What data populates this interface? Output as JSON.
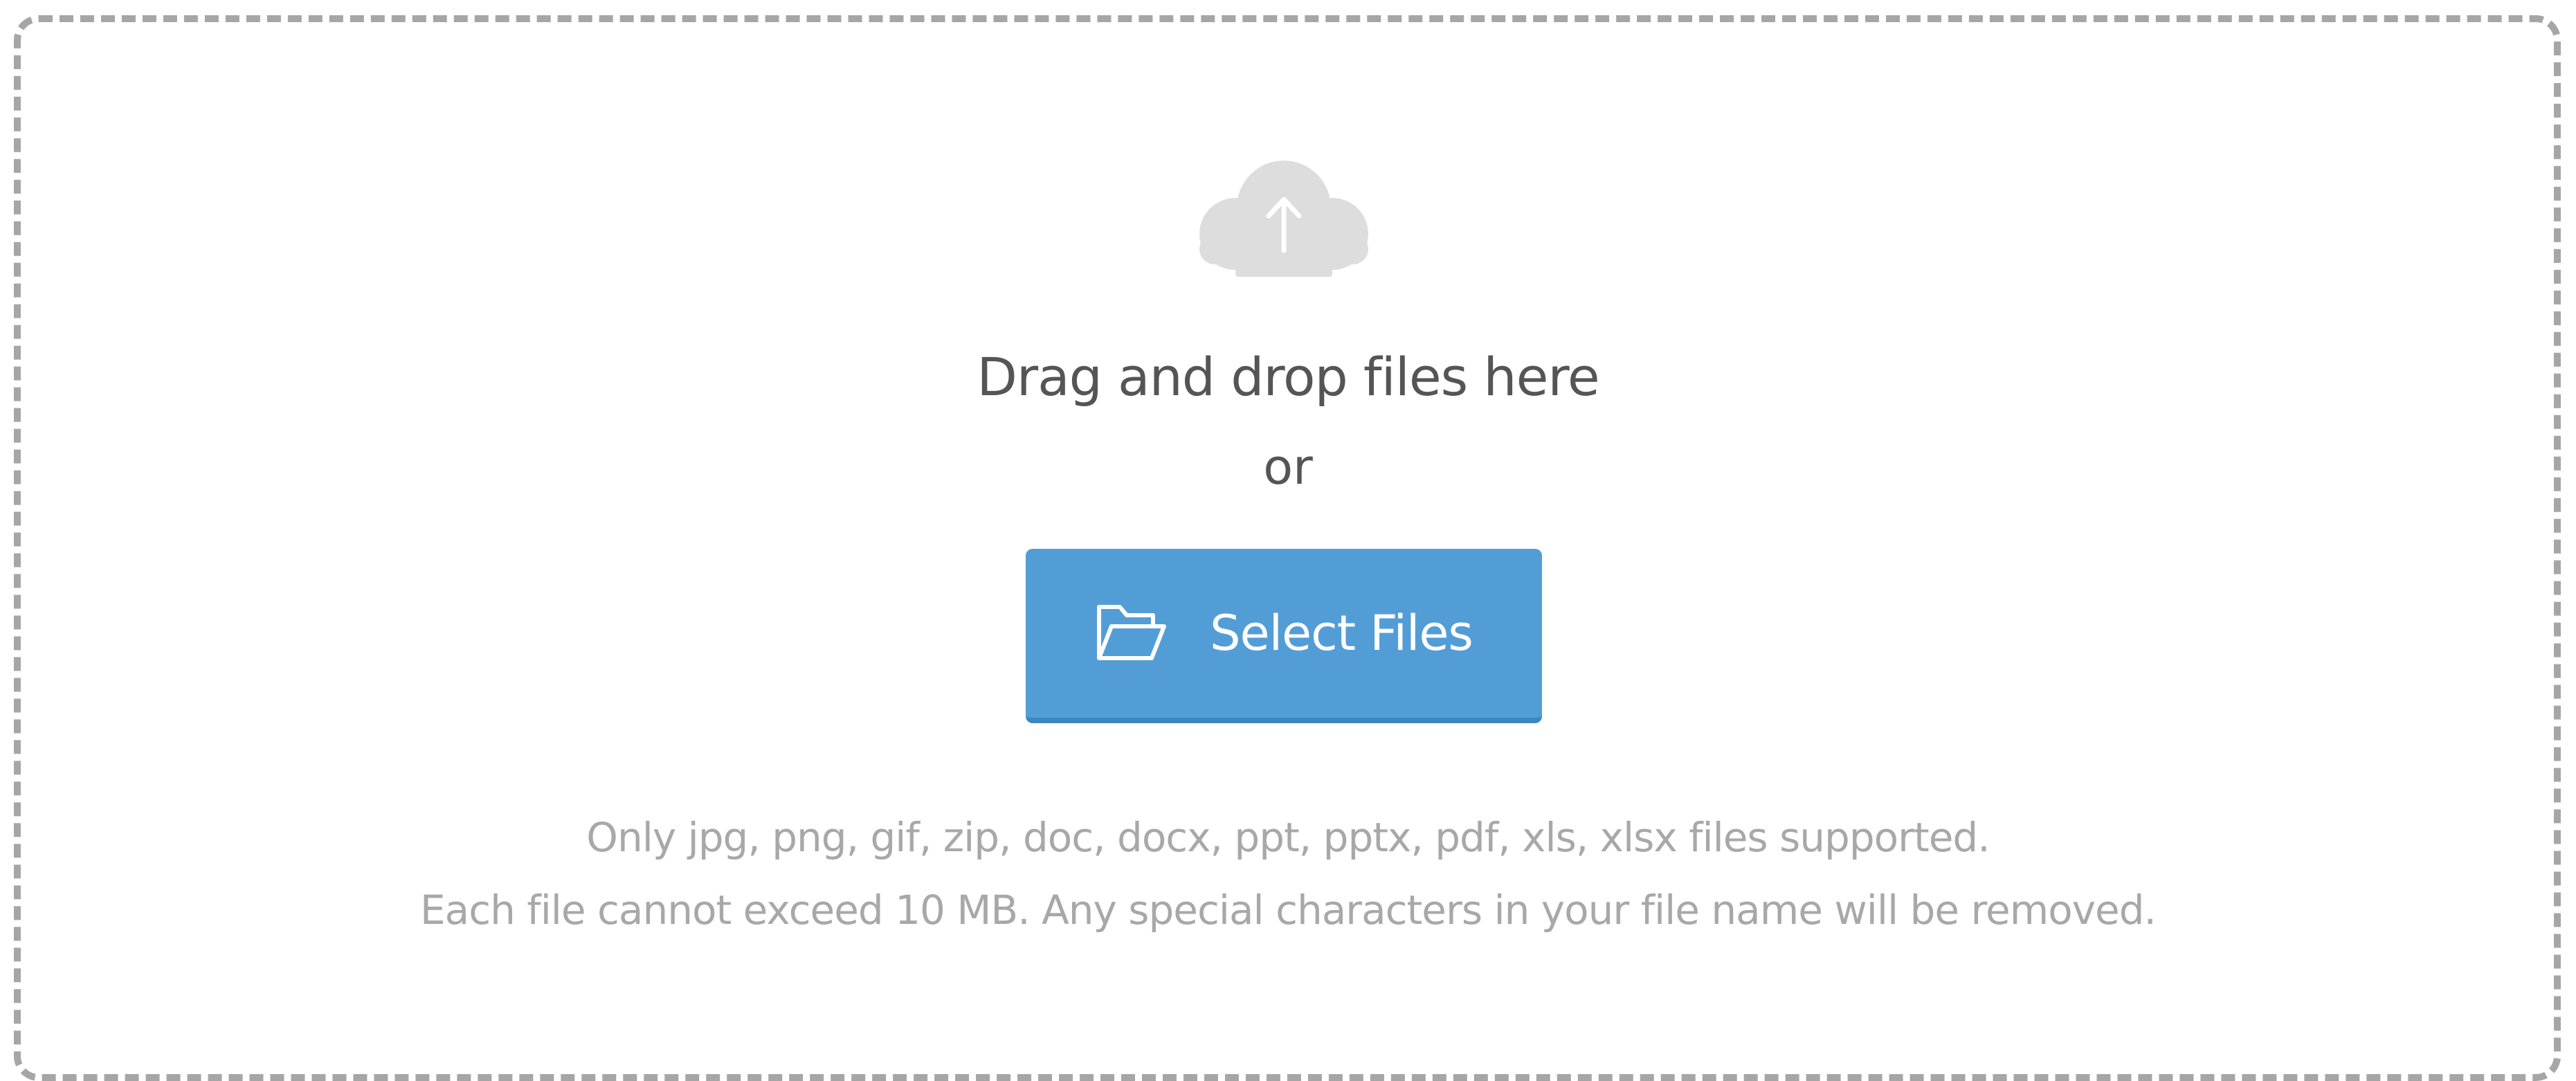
{
  "upload": {
    "icon": "cloud-upload-icon",
    "headline": "Drag and drop files here",
    "or_text": "or",
    "button": {
      "icon": "folder-open-icon",
      "label": "Select Files"
    },
    "info_line_1": "Only jpg, png, gif, zip, doc, docx, ppt, pptx, pdf, xls, xlsx files supported.",
    "info_line_2": "Each file cannot exceed 10 MB. Any special characters in your file name will be removed."
  },
  "colors": {
    "button_bg": "#539dd7",
    "cloud": "#dddddd",
    "border": "#a6a6a6",
    "headline_text": "#555555",
    "info_text": "#a8a8a8"
  }
}
